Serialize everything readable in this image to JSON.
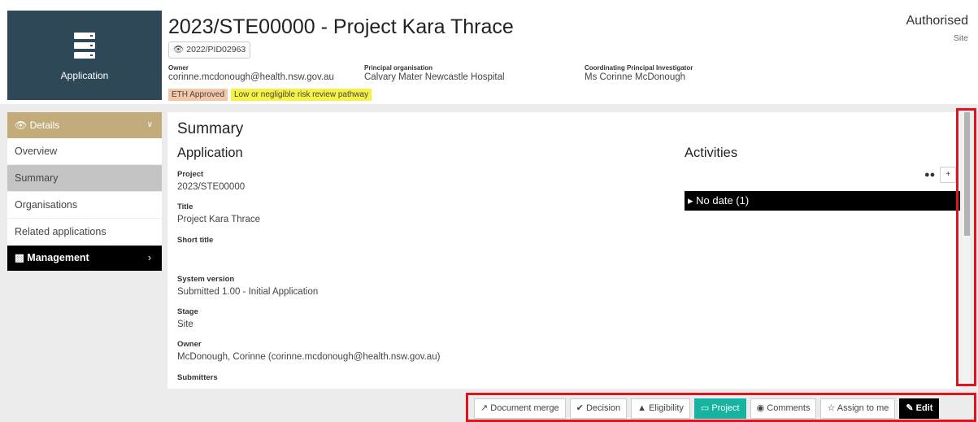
{
  "header": {
    "app_label": "Application",
    "title": "2023/STE00000 - Project Kara Thrace",
    "pid": "2022/PID02963",
    "owner_label": "Owner",
    "owner_value": "corinne.mcdonough@health.nsw.gov.au",
    "org_label": "Principal organisation",
    "org_value": "Calvary Mater Newcastle Hospital",
    "cpi_label": "Coordinating Principal Investigator",
    "cpi_value": "Ms Corinne McDonough",
    "tag1": "ETH Approved",
    "tag2": "Low or negligible risk review pathway",
    "status": "Authorised",
    "status_sub": "Site"
  },
  "sidebar": {
    "header": "Details",
    "items": [
      {
        "label": "Overview"
      },
      {
        "label": "Summary"
      },
      {
        "label": "Organisations"
      },
      {
        "label": "Related applications"
      }
    ],
    "management": "Management"
  },
  "main": {
    "heading": "Summary",
    "section": "Application",
    "fields": [
      {
        "label": "Project",
        "value": "2023/STE00000"
      },
      {
        "label": "Title",
        "value": "Project Kara Thrace"
      },
      {
        "label": "Short title",
        "value": ""
      },
      {
        "label": "System version",
        "value": "Submitted 1.00 - Initial Application"
      },
      {
        "label": "Stage",
        "value": "Site"
      },
      {
        "label": "Owner",
        "value": "McDonough, Corinne (corinne.mcdonough@health.nsw.gov.au)"
      },
      {
        "label": "Submitters",
        "value": ""
      }
    ],
    "activities_heading": "Activities",
    "no_date": "No date (1)"
  },
  "toolbar": {
    "document_merge": "Document merge",
    "decision": "Decision",
    "eligibility": "Eligibility",
    "project": "Project",
    "comments": "Comments",
    "assign": "Assign to me",
    "edit": "Edit"
  },
  "colors": {
    "tile": "#2f4858",
    "sidebar_header": "#c2ac7c",
    "active": "#c4c4c4",
    "project_button": "#16b4a0",
    "highlight": "#e0141e",
    "eth_tag": "#f4c7a8",
    "risk_tag": "#f5f245"
  }
}
